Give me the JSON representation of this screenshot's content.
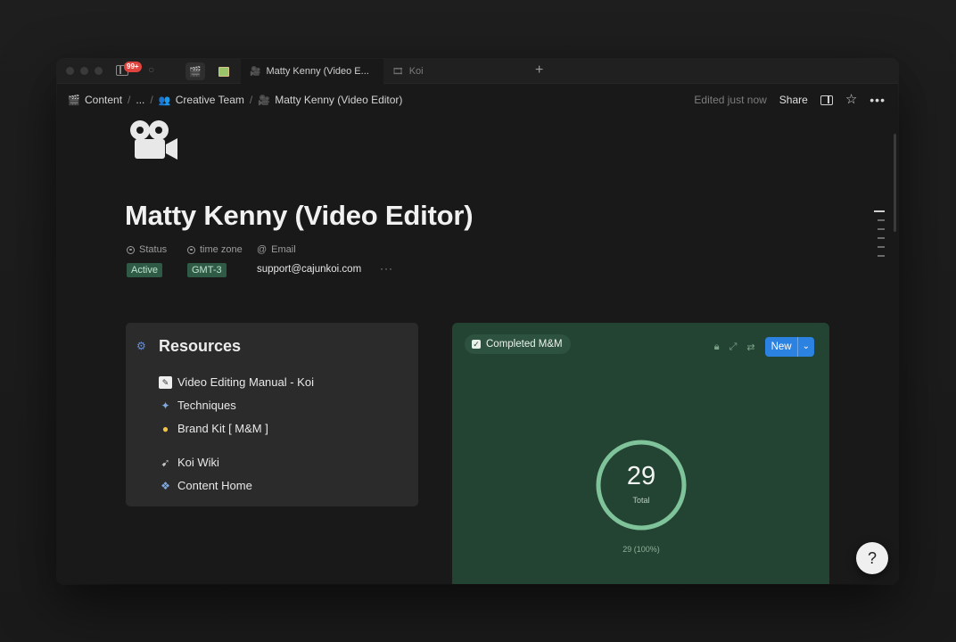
{
  "tabbar": {
    "notification_badge": "99+",
    "tabs": [
      {
        "label": "Matty Kenny (Video E...",
        "icon": "movie-camera-icon",
        "active": true
      },
      {
        "label": "Koi",
        "icon": "koi-page-icon",
        "active": false
      }
    ],
    "new_tab": "+"
  },
  "breadcrumb": {
    "items": [
      {
        "label": "Content",
        "icon": "clapperboard-icon"
      },
      {
        "label": "...",
        "icon": ""
      },
      {
        "label": "Creative Team",
        "icon": "people-icon"
      },
      {
        "label": "Matty Kenny (Video Editor)",
        "icon": "movie-camera-icon"
      }
    ],
    "separator": "/"
  },
  "topbar": {
    "edited": "Edited just now",
    "share": "Share"
  },
  "page": {
    "title": "Matty Kenny (Video Editor)",
    "icon": "movie-camera-icon"
  },
  "properties": {
    "status_label": "Status",
    "timezone_label": "time zone",
    "email_label": "Email",
    "status_value": "Active",
    "timezone_value": "GMT-3",
    "email_value": "support@cajunkoi.com",
    "more": "···"
  },
  "resources": {
    "title": "Resources",
    "items": [
      {
        "label": "Video Editing Manual - Koi",
        "icon": "handbook-icon"
      },
      {
        "label": "Techniques",
        "icon": "wand-icon"
      },
      {
        "label": "Brand Kit [ M&M ]",
        "icon": "lightbulb-icon"
      },
      {
        "label": "Koi Wiki",
        "icon": "fish-icon"
      },
      {
        "label": "Content Home",
        "icon": "folder-icon"
      }
    ]
  },
  "chart_widget": {
    "view_name": "Completed M&M",
    "new_button": "New",
    "accent": "#2b82e0",
    "background": "#244433"
  },
  "chart_data": {
    "type": "pie",
    "total": 29,
    "total_label": "Total",
    "slices": [
      {
        "value": 29,
        "label": "29 (100%)"
      }
    ],
    "ring_color": "#7fc39a"
  },
  "help": {
    "label": "?"
  }
}
